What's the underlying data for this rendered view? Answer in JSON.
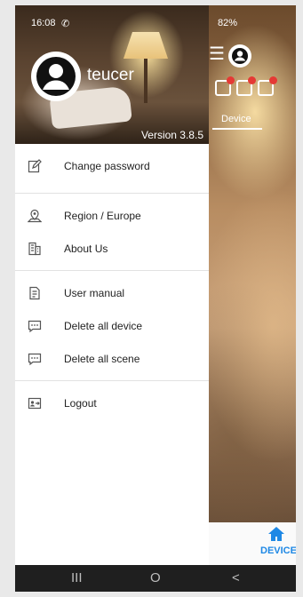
{
  "status_bar": {
    "time": "16:08",
    "call_glyph": "✆",
    "right": "82%"
  },
  "drawer": {
    "username": "teucer",
    "version": "Version 3.8.5",
    "items": [
      {
        "label": "Change password",
        "icon": "edit-icon"
      },
      {
        "label": "Region / Europe",
        "icon": "location-icon"
      },
      {
        "label": "About Us",
        "icon": "building-icon"
      },
      {
        "label": "User manual",
        "icon": "document-icon"
      },
      {
        "label": "Delete all device",
        "icon": "message-icon"
      },
      {
        "label": "Delete all scene",
        "icon": "message-icon"
      },
      {
        "label": "Logout",
        "icon": "logout-icon"
      }
    ]
  },
  "background_app": {
    "tab_label": "Device",
    "bottom_nav_label": "DEVICE",
    "accent_color": "#1e88e5"
  },
  "nav_bar": {
    "recents": "III",
    "home": "O",
    "back": "<"
  }
}
